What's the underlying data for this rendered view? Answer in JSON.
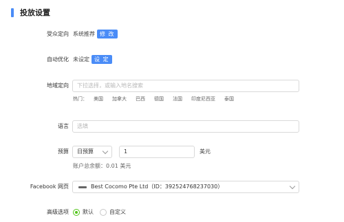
{
  "section": {
    "title": "投放设置"
  },
  "audience": {
    "label": "受众定向",
    "value": "系统推荐",
    "button": "修 改"
  },
  "auto_opt": {
    "label": "自动优化",
    "value": "未设定",
    "button": "设 定"
  },
  "region": {
    "label": "地域定向",
    "placeholder": "下拉选择，或输入地名搜索",
    "hot_label": "热门：",
    "hot_items": [
      "美国",
      "加拿大",
      "巴西",
      "德国",
      "法国",
      "印度尼西亚",
      "泰国"
    ]
  },
  "language": {
    "label": "语言",
    "placeholder": "选填"
  },
  "budget": {
    "label": "预算",
    "type_value": "日预算",
    "amount": "1",
    "unit": "美元",
    "balance_text": "账户总余额：0.01 美元"
  },
  "facebook": {
    "label": "Facebook 网页",
    "page_value": "Best Cocomo Pte Ltd（ID：392524768237030）"
  },
  "advanced": {
    "label": "高级选项",
    "option_default": "默认",
    "option_custom": "自定义",
    "selected": "默认"
  },
  "colors": {
    "accent": "#4a8cf7",
    "radio_selected": "#52c41a"
  }
}
